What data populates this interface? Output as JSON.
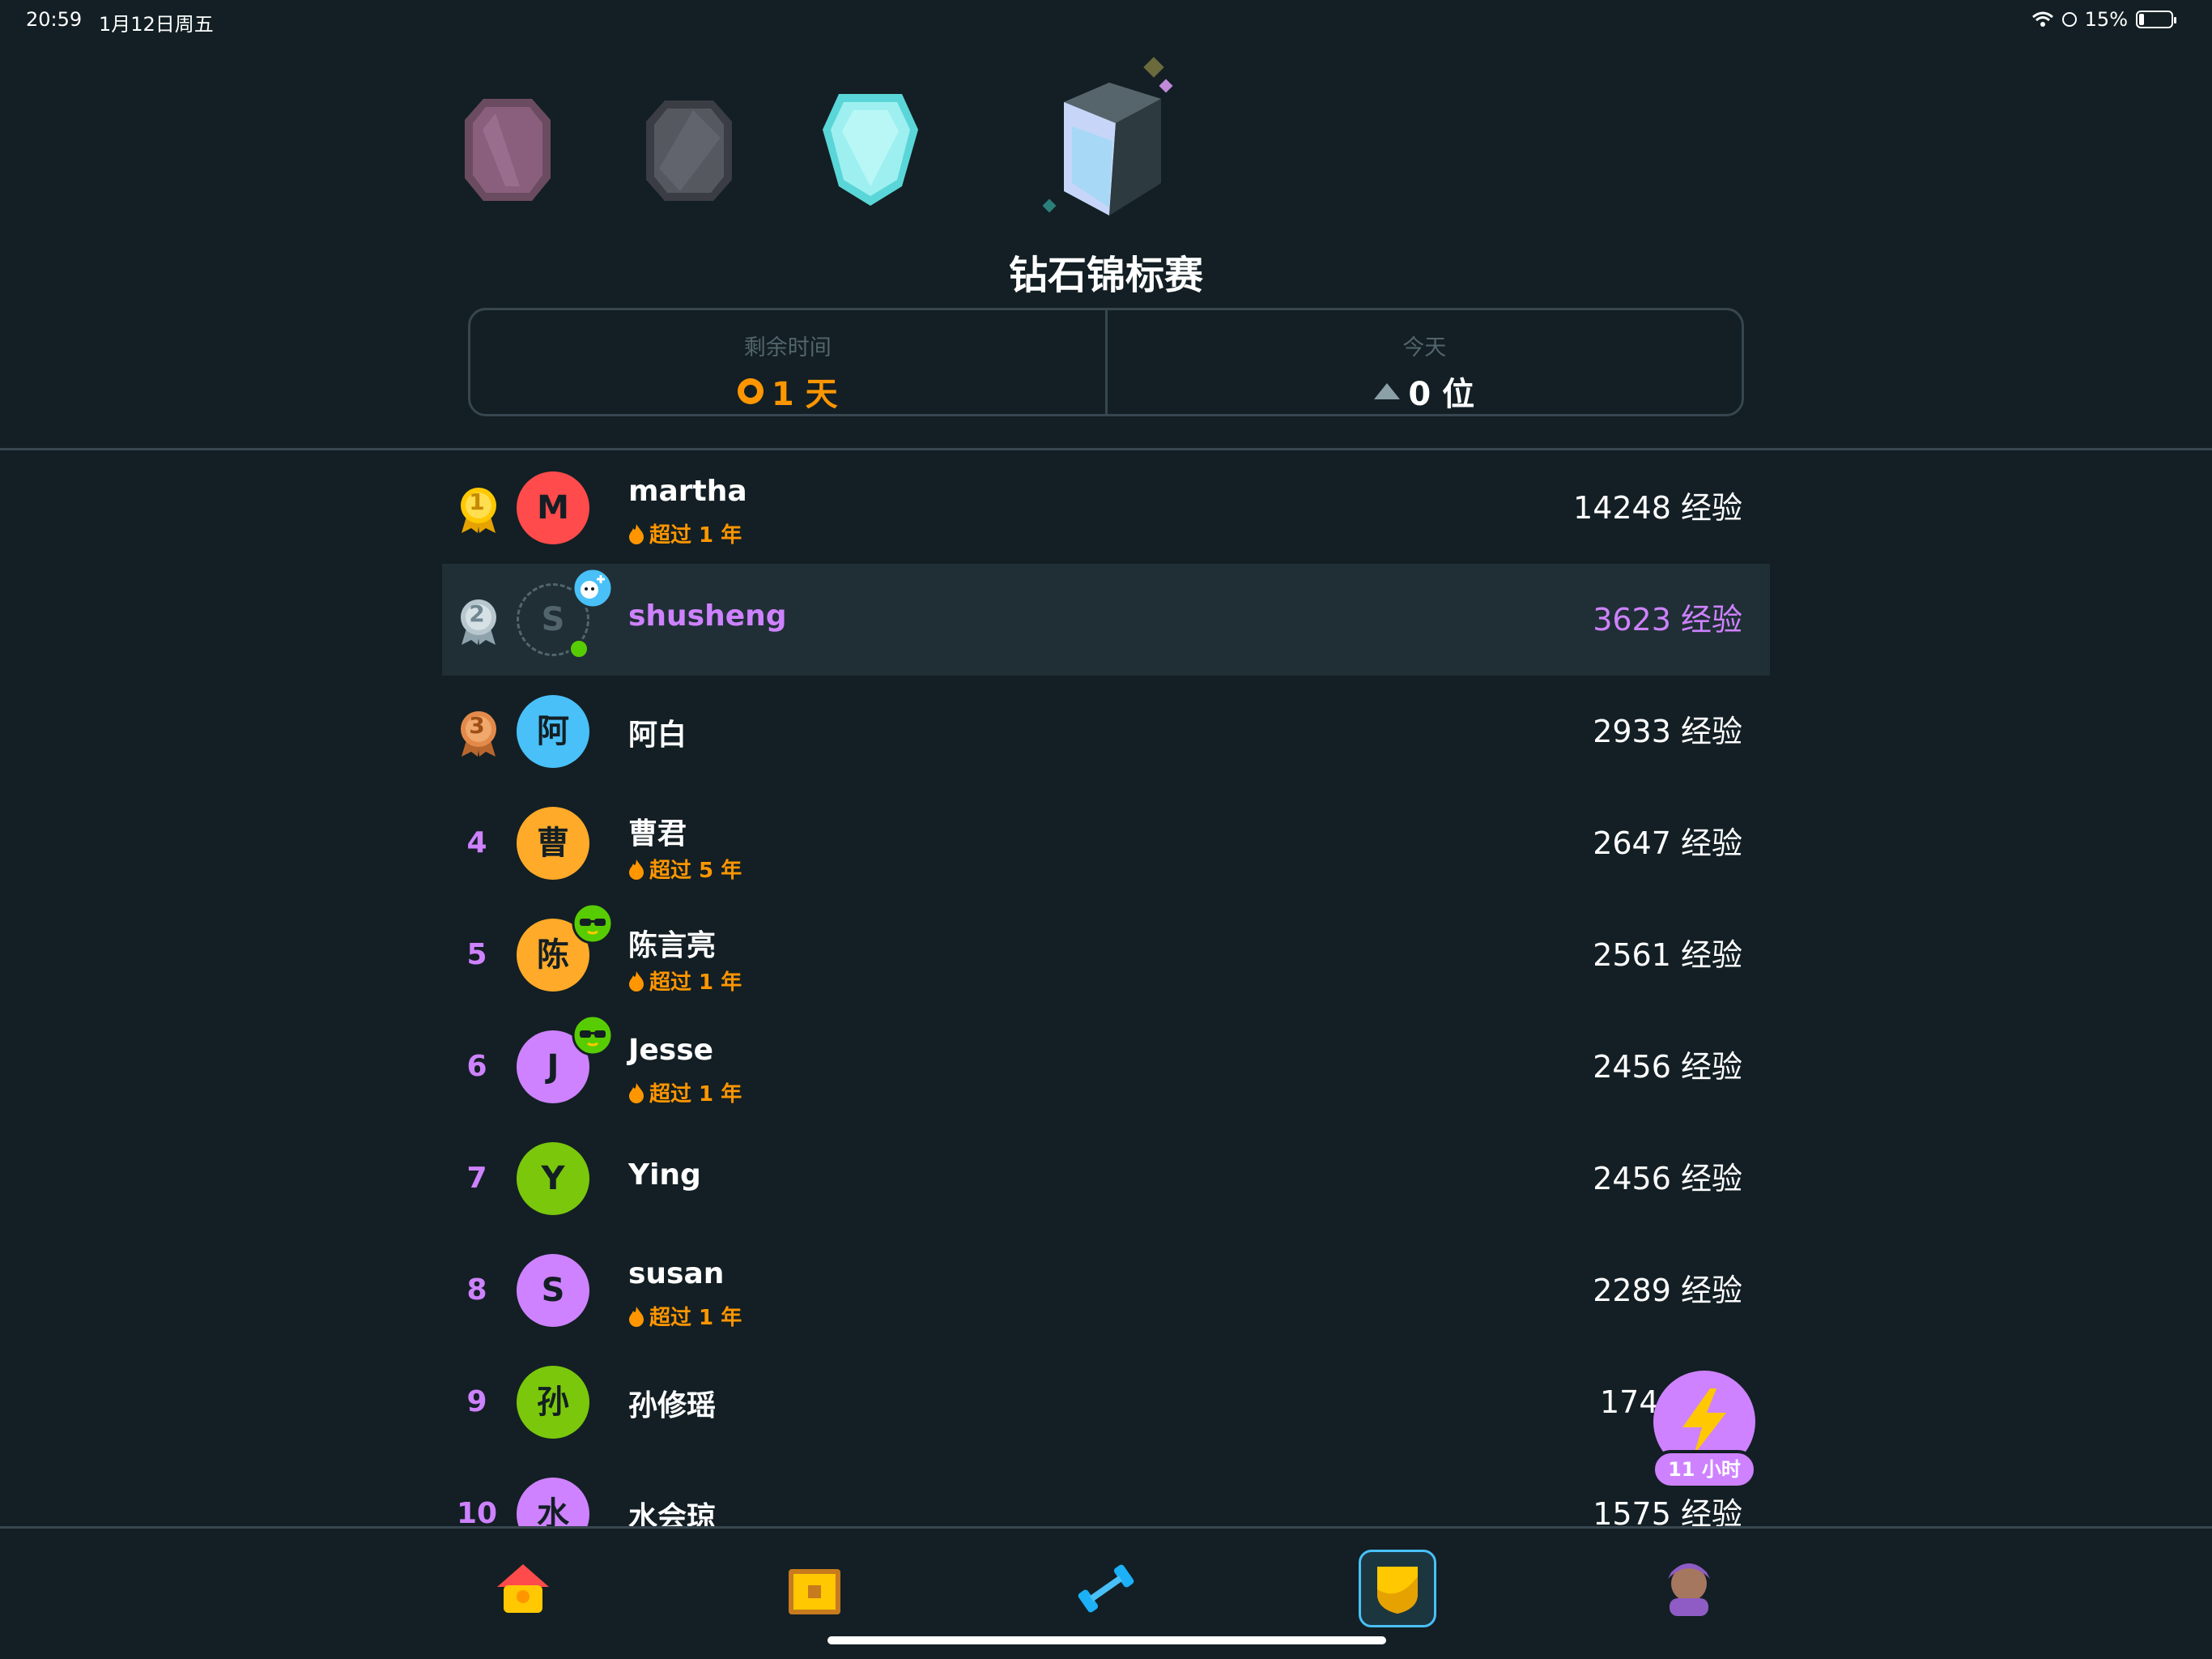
{
  "status_bar": {
    "time": "20:59",
    "date": "1月12日周五",
    "battery": "15%"
  },
  "league": {
    "title": "钻石锦标赛"
  },
  "stats": {
    "time_left_label": "剩余时间",
    "time_left_value": "1 天",
    "today_label": "今天",
    "today_value": "0 位"
  },
  "leaderboard": [
    {
      "rank": "1",
      "initial": "M",
      "name": "martha",
      "streak": "超过 1 年",
      "xp": "14248 经验",
      "avatar_color": "#ff4b4b",
      "medal_color": "#ffc800"
    },
    {
      "rank": "2",
      "initial": "S",
      "name": "shusheng",
      "streak": "",
      "xp": "3623 经验",
      "avatar_color": "",
      "medal_color": "#b8c7ce"
    },
    {
      "rank": "3",
      "initial": "阿",
      "name": "阿白",
      "streak": "",
      "xp": "2933 经验",
      "avatar_color": "#49c0f8",
      "medal_color": "#e38a4a"
    },
    {
      "rank": "4",
      "initial": "曹",
      "name": "曹君",
      "streak": "超过 5 年",
      "xp": "2647 经验",
      "avatar_color": "#ffaa29"
    },
    {
      "rank": "5",
      "initial": "陈",
      "name": "陈言亮",
      "streak": "超过 1 年",
      "xp": "2561 经验",
      "avatar_color": "#ffaa29"
    },
    {
      "rank": "6",
      "initial": "J",
      "name": "Jesse",
      "streak": "超过 1 年",
      "xp": "2456 经验",
      "avatar_color": "#ce82ff"
    },
    {
      "rank": "7",
      "initial": "Y",
      "name": "Ying",
      "streak": "",
      "xp": "2456 经验",
      "avatar_color": "#7ac70c"
    },
    {
      "rank": "8",
      "initial": "S",
      "name": "susan",
      "streak": "超过 1 年",
      "xp": "2289 经验",
      "avatar_color": "#ce82ff"
    },
    {
      "rank": "9",
      "initial": "孙",
      "name": "孙修瑶",
      "streak": "",
      "xp": "174",
      "avatar_color": "#7ac70c"
    },
    {
      "rank": "10",
      "initial": "水",
      "name": "水会琼",
      "streak": "",
      "xp": "1575 经验",
      "avatar_color": "#ce82ff"
    }
  ],
  "boost": {
    "label": "11 小时"
  },
  "colors": {
    "background": "#131f24",
    "accent_purple": "#ce82ff",
    "orange": "#ff9600",
    "border": "#37464f"
  },
  "icons": {
    "status": [
      "wifi-icon",
      "lock-rotation-icon",
      "battery-icon"
    ],
    "tabs": [
      "home-icon",
      "treasure-chest-icon",
      "dumbbell-icon",
      "league-shield-icon",
      "profile-avatar-icon"
    ]
  }
}
